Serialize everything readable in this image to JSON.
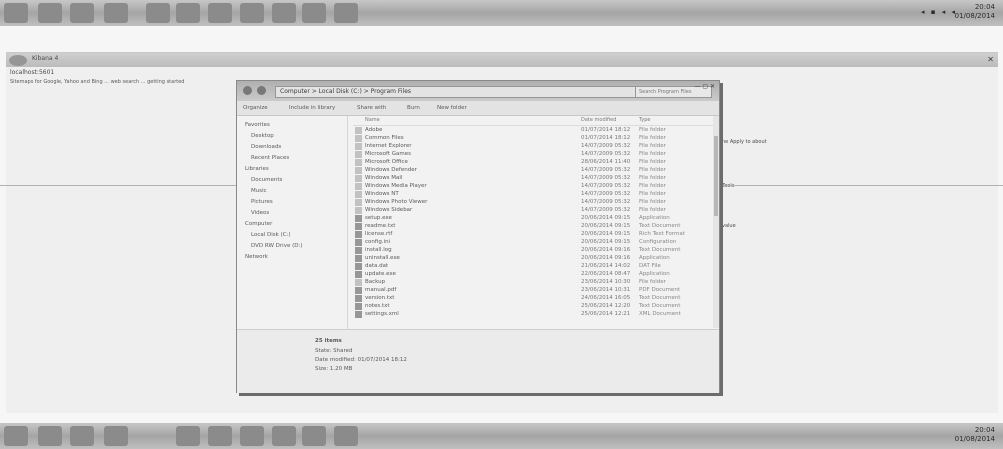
{
  "tray": {
    "time": "20:04",
    "date": "01/08/2014",
    "icons": "◂ ▪ ◂ ◂"
  },
  "browser": {
    "tab_label": "Kibana 4",
    "address": "localhost:5601",
    "bookmarks": "Sitemaps for Google, Yahoo and Bing ... web search ... getting started",
    "side_texts": [
      "he Apply to about",
      "Tools",
      "value"
    ]
  },
  "explorer": {
    "path": "Computer > Local Disk (C:) > Program Files",
    "search_placeholder": "Search Program Files",
    "caption": "— ▢ ✕",
    "toolbar": [
      "Organize",
      "Include in library",
      "Share with",
      "Burn",
      "New folder"
    ],
    "nav_items": [
      {
        "label": "Favorites",
        "group": true
      },
      {
        "label": "Desktop",
        "group": false
      },
      {
        "label": "Downloads",
        "group": false
      },
      {
        "label": "Recent Places",
        "group": false
      },
      {
        "label": "Libraries",
        "group": true
      },
      {
        "label": "Documents",
        "group": false
      },
      {
        "label": "Music",
        "group": false
      },
      {
        "label": "Pictures",
        "group": false
      },
      {
        "label": "Videos",
        "group": false
      },
      {
        "label": "Computer",
        "group": true
      },
      {
        "label": "Local Disk (C:)",
        "group": false
      },
      {
        "label": "DVD RW Drive (D:)",
        "group": false
      },
      {
        "label": "Network",
        "group": true
      }
    ],
    "headers": [
      "Name",
      "Date modified",
      "Type"
    ],
    "rows": [
      {
        "name": "Adobe",
        "date": "01/07/2014 18:12",
        "type": "File folder",
        "kind": "folder"
      },
      {
        "name": "Common Files",
        "date": "01/07/2014 18:12",
        "type": "File folder",
        "kind": "folder"
      },
      {
        "name": "Internet Explorer",
        "date": "14/07/2009 05:32",
        "type": "File folder",
        "kind": "folder"
      },
      {
        "name": "Microsoft Games",
        "date": "14/07/2009 05:32",
        "type": "File folder",
        "kind": "folder"
      },
      {
        "name": "Microsoft Office",
        "date": "28/06/2014 11:40",
        "type": "File folder",
        "kind": "folder"
      },
      {
        "name": "Windows Defender",
        "date": "14/07/2009 05:32",
        "type": "File folder",
        "kind": "folder"
      },
      {
        "name": "Windows Mail",
        "date": "14/07/2009 05:32",
        "type": "File folder",
        "kind": "folder"
      },
      {
        "name": "Windows Media Player",
        "date": "14/07/2009 05:32",
        "type": "File folder",
        "kind": "folder"
      },
      {
        "name": "Windows NT",
        "date": "14/07/2009 05:32",
        "type": "File folder",
        "kind": "folder"
      },
      {
        "name": "Windows Photo Viewer",
        "date": "14/07/2009 05:32",
        "type": "File folder",
        "kind": "folder"
      },
      {
        "name": "Windows Sidebar",
        "date": "14/07/2009 05:32",
        "type": "File folder",
        "kind": "folder"
      },
      {
        "name": "setup.exe",
        "date": "20/06/2014 09:15",
        "type": "Application",
        "kind": "file"
      },
      {
        "name": "readme.txt",
        "date": "20/06/2014 09:15",
        "type": "Text Document",
        "kind": "file"
      },
      {
        "name": "license.rtf",
        "date": "20/06/2014 09:15",
        "type": "Rich Text Format",
        "kind": "file"
      },
      {
        "name": "config.ini",
        "date": "20/06/2014 09:15",
        "type": "Configuration",
        "kind": "file"
      },
      {
        "name": "install.log",
        "date": "20/06/2014 09:16",
        "type": "Text Document",
        "kind": "file"
      },
      {
        "name": "uninstall.exe",
        "date": "20/06/2014 09:16",
        "type": "Application",
        "kind": "file"
      },
      {
        "name": "data.dat",
        "date": "21/06/2014 14:02",
        "type": "DAT File",
        "kind": "file"
      },
      {
        "name": "update.exe",
        "date": "22/06/2014 08:47",
        "type": "Application",
        "kind": "file"
      },
      {
        "name": "Backup",
        "date": "23/06/2014 10:30",
        "type": "File folder",
        "kind": "folder"
      },
      {
        "name": "manual.pdf",
        "date": "23/06/2014 10:31",
        "type": "PDF Document",
        "kind": "file"
      },
      {
        "name": "version.txt",
        "date": "24/06/2014 16:05",
        "type": "Text Document",
        "kind": "file"
      },
      {
        "name": "notes.txt",
        "date": "25/06/2014 12:20",
        "type": "Text Document",
        "kind": "file"
      },
      {
        "name": "settings.xml",
        "date": "25/06/2014 12:21",
        "type": "XML Document",
        "kind": "file"
      }
    ],
    "details": {
      "title": "25 items",
      "line1": "State: Shared",
      "line2": "Date modified: 01/07/2014 18:12",
      "line3": "Size: 1.20 MB"
    }
  }
}
